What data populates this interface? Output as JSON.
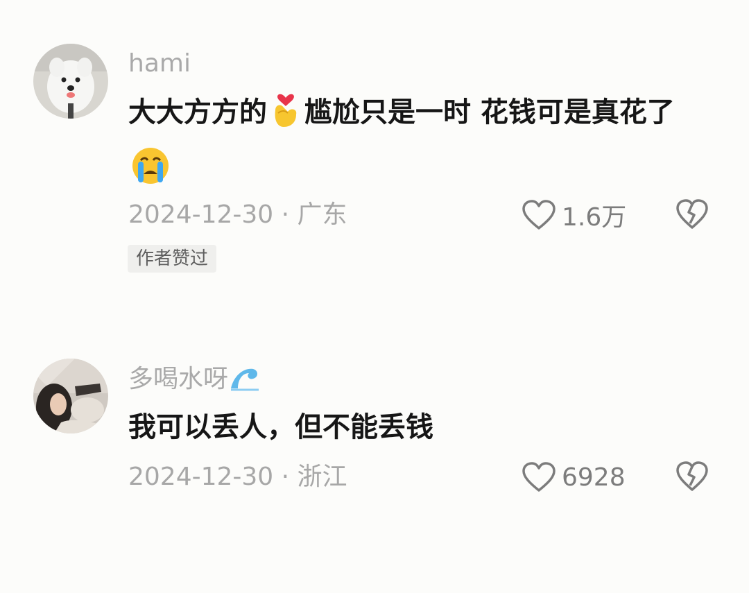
{
  "comments": [
    {
      "username": "hami",
      "text_part1": "大大方方的",
      "text_part2": "尴尬只是一时 花钱可是真花了",
      "date_location": "2024-12-30 · 广东",
      "likes": "1.6万",
      "badge": "作者赞过",
      "emojis": [
        "finger-heart-emoji",
        "crying-face-emoji"
      ]
    },
    {
      "username": "多喝水呀",
      "username_emoji": "wave-emoji",
      "text": "我可以丢人，但不能丢钱",
      "date_location": "2024-12-30 · 浙江",
      "likes": "6928"
    }
  ],
  "colors": {
    "background": "#fcfcfa",
    "username": "#a9a9a9",
    "body": "#161616",
    "meta": "#a7a7a7",
    "icon": "#7c7c7c"
  }
}
